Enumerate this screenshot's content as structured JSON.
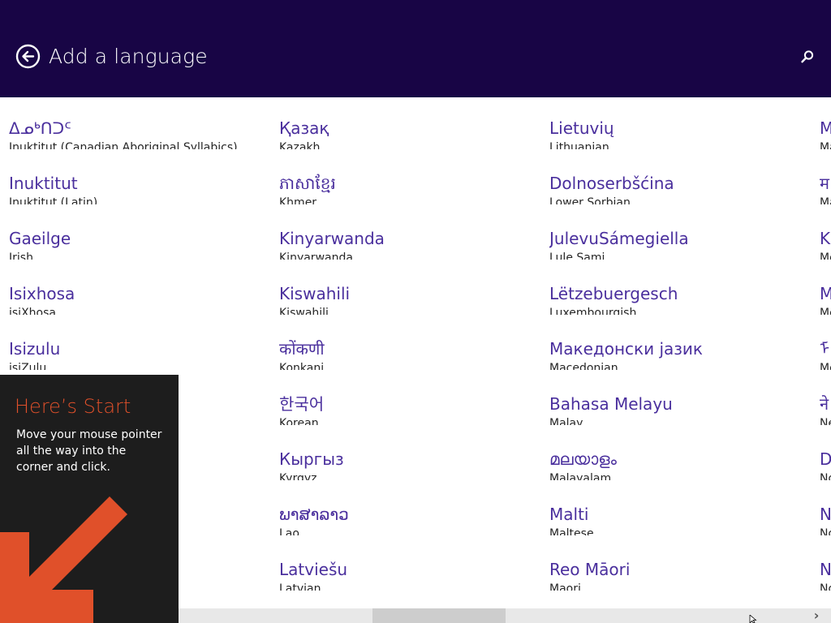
{
  "header": {
    "title": "Add a language",
    "back_icon": "back-arrow-circle-icon",
    "search_icon": "search-icon"
  },
  "languages": [
    {
      "native": "ᐃᓄᒃᑎᑐᑦ",
      "english": "Inuktitut (Canadian Aboriginal Syllabics)"
    },
    {
      "native": "Inuktitut",
      "english": "Inuktitut (Latin)"
    },
    {
      "native": "Gaeilge",
      "english": "Irish"
    },
    {
      "native": "Isixhosa",
      "english": "isiXhosa"
    },
    {
      "native": "Isizulu",
      "english": "isiZulu"
    },
    {
      "native": "Қазақ",
      "english": "Kazakh"
    },
    {
      "native": "ភាសាខ្មែរ",
      "english": "Khmer"
    },
    {
      "native": "Kinyarwanda",
      "english": "Kinyarwanda"
    },
    {
      "native": "Kiswahili",
      "english": "Kiswahili"
    },
    {
      "native": "कोंकणी",
      "english": "Konkani"
    },
    {
      "native": "한국어",
      "english": "Korean"
    },
    {
      "native": "Кыргыз",
      "english": "Kyrgyz"
    },
    {
      "native": "ພາສາລາວ",
      "english": "Lao"
    },
    {
      "native": "Latviešu",
      "english": "Latvian"
    },
    {
      "native": "Lietuvių",
      "english": "Lithuanian"
    },
    {
      "native": "Dolnoserbšćina",
      "english": "Lower Sorbian"
    },
    {
      "native": "JulevuSámegiella",
      "english": "Lule Sami"
    },
    {
      "native": "Lëtzebuergesch",
      "english": "Luxembourgish"
    },
    {
      "native": "Македонски јазик",
      "english": "Macedonian"
    },
    {
      "native": "Bahasa Melayu",
      "english": "Malay"
    },
    {
      "native": "മലയാളം",
      "english": "Malayalam"
    },
    {
      "native": "Malti",
      "english": "Maltese"
    },
    {
      "native": "Reo Māori",
      "english": "Maori"
    },
    {
      "native": "M",
      "english": "Ma"
    },
    {
      "native": "म",
      "english": "Ma"
    },
    {
      "native": "K",
      "english": "Mo"
    },
    {
      "native": "M",
      "english": "Mo"
    },
    {
      "native": "ᠮ",
      "english": "Mo"
    },
    {
      "native": "ने",
      "english": "Ne"
    },
    {
      "native": "D",
      "english": "No"
    },
    {
      "native": "N",
      "english": "No"
    },
    {
      "native": "N",
      "english": "No"
    }
  ],
  "start_tip": {
    "title": "Here’s Start",
    "body": "Move your mouse pointer all the way into the corner and click."
  },
  "scrollbar": {
    "right_arrow": "›"
  },
  "colors": {
    "header_bg": "#180545",
    "language_name": "#4a2f9d",
    "tip_bg": "#1d1d1d",
    "tip_accent": "#e0502a"
  }
}
